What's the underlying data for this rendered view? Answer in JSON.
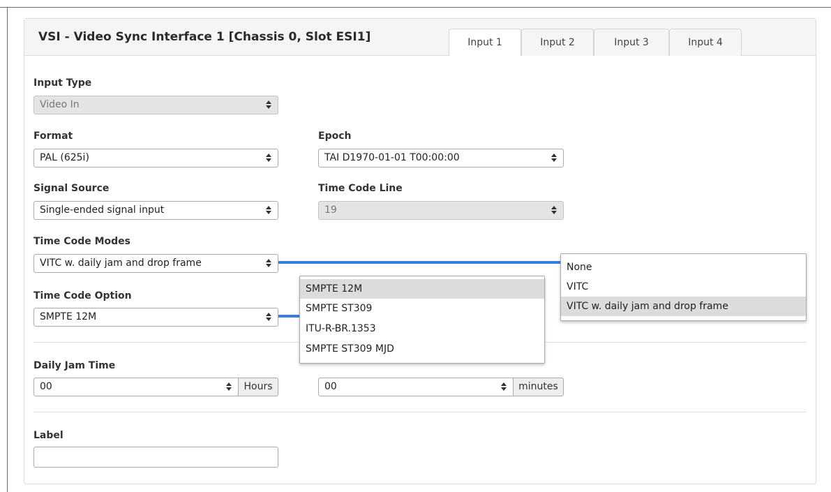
{
  "panel": {
    "title": "VSI - Video Sync Interface 1 [Chassis 0, Slot ESI1]",
    "tabs": [
      {
        "label": "Input 1",
        "active": true
      },
      {
        "label": "Input 2",
        "active": false
      },
      {
        "label": "Input 3",
        "active": false
      },
      {
        "label": "Input 4",
        "active": false
      }
    ]
  },
  "form": {
    "input_type": {
      "label": "Input Type",
      "value": "Video In",
      "disabled": true
    },
    "format": {
      "label": "Format",
      "value": "PAL (625i)"
    },
    "epoch": {
      "label": "Epoch",
      "value": "TAI D1970-01-01 T00:00:00"
    },
    "signal_source": {
      "label": "Signal Source",
      "value": "Single-ended signal input"
    },
    "time_code_line": {
      "label": "Time Code Line",
      "value": "19",
      "disabled": true
    },
    "time_code_modes": {
      "label": "Time Code Modes",
      "value": "VITC w. daily jam and drop frame",
      "options": [
        "None",
        "VITC",
        "VITC w. daily jam and drop frame"
      ],
      "highlighted": "VITC w. daily jam and drop frame"
    },
    "time_code_option": {
      "label": "Time Code Option",
      "value": "SMPTE 12M",
      "options": [
        "SMPTE 12M",
        "SMPTE ST309",
        "ITU-R-BR.1353",
        "SMPTE ST309 MJD"
      ],
      "highlighted": "SMPTE 12M"
    },
    "daily_jam_time": {
      "label": "Daily Jam Time",
      "hours_value": "00",
      "hours_unit": "Hours",
      "minutes_value": "00",
      "minutes_unit": "minutes"
    },
    "label_field": {
      "label": "Label",
      "value": ""
    }
  },
  "colors": {
    "connector": "#3a7de0",
    "highlight": "#dcdcdc",
    "header_bg": "#f5f5f5"
  }
}
